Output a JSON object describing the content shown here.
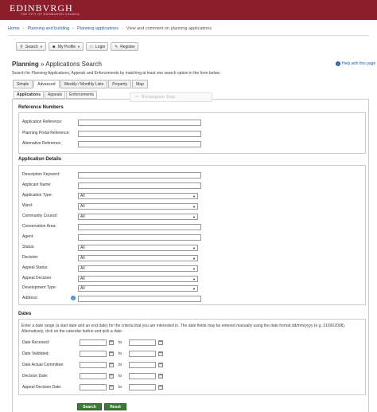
{
  "header": {
    "logo": "EDINBVRGH",
    "logo_sub": "THE CITY OF EDINBURGH COUNCIL"
  },
  "breadcrumb": {
    "items": [
      "Home",
      "Planning and building",
      "Planning applications"
    ],
    "current": "View and comment on planning applications"
  },
  "toolbar": {
    "search": "Search",
    "profile": "My Profile",
    "login": "Login",
    "register": "Register"
  },
  "page": {
    "title_main": "Planning",
    "title_sep": "»",
    "title_sub": "Applications Search",
    "help": "Help with this page",
    "intro": "Search for Planning Applications, Appeals and Enforcements by matching at least one search option in the form below."
  },
  "tabs": [
    "Simple",
    "Advanced",
    "Weekly / Monthly Lists",
    "Property",
    "Map"
  ],
  "subtabs": [
    "Applications",
    "Appeals",
    "Enforcements"
  ],
  "snip_overlay": "Rectangular Snip",
  "reference": {
    "title": "Reference Numbers",
    "fields": [
      "Application Reference:",
      "Planning Portal Reference:",
      "Alternative Reference:"
    ]
  },
  "details": {
    "title": "Application Details",
    "keyword": "Description Keyword:",
    "applicant": "Applicant Name:",
    "app_type": "Application Type:",
    "ward": "Ward:",
    "council": "Community Council:",
    "conservation": "Conservation Area:",
    "agent": "Agent:",
    "status": "Status:",
    "decision": "Decision:",
    "appeal_status": "Appeal Status:",
    "appeal_decision": "Appeal Decision:",
    "dev_type": "Development Type:",
    "address": "Address:",
    "all": "All"
  },
  "dates": {
    "title": "Dates",
    "intro": "Enter a date range (a start date and an end date) for the criteria that you are interested in. The date fields may be entered manually using the date format dd/mm/yyyy (e.g. 21/06/2008). Alternatively, click on the calendar button and pick a date.",
    "fields": [
      "Date Received:",
      "Date Validated:",
      "Date Actual Committee:",
      "Decision Date:",
      "Appeal Decision Date:"
    ],
    "to": "to"
  },
  "actions": {
    "search": "Search",
    "reset": "Reset"
  }
}
